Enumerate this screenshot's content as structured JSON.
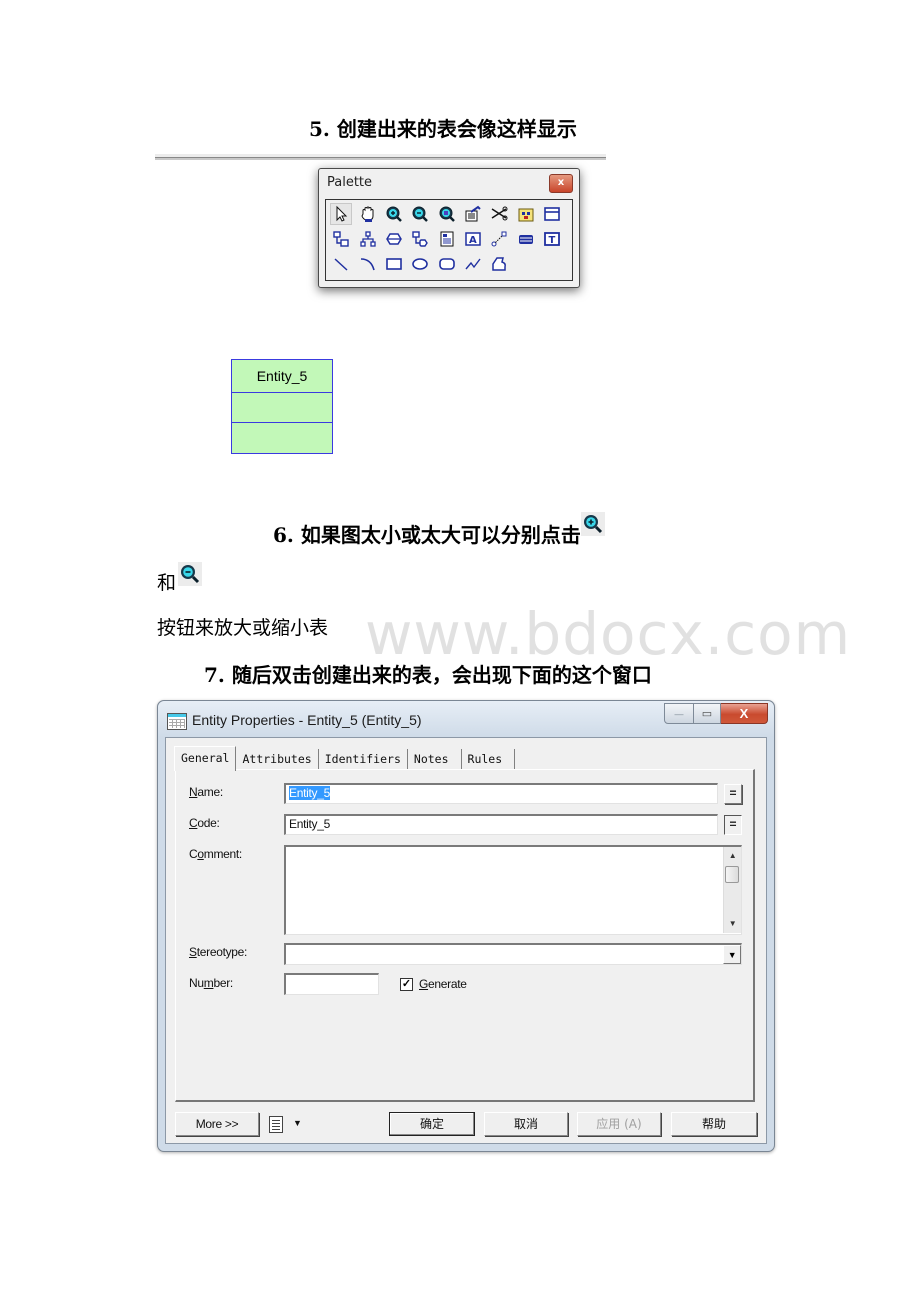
{
  "step5": {
    "heading": "5. 创建出来的表会像这样显示"
  },
  "palette": {
    "title": "Palette",
    "close_label": "x",
    "tools": [
      [
        "pointer",
        "hand",
        "zoom-in",
        "zoom-out",
        "zoom-fit",
        "properties",
        "cut",
        "package",
        "entity"
      ],
      [
        "inheritance",
        "hierarchy",
        "association",
        "association-link",
        "file",
        "text-file",
        "link",
        "table",
        "text"
      ],
      [
        "line",
        "arc",
        "rectangle",
        "ellipse",
        "rounded-rectangle",
        "polyline",
        "polygon"
      ]
    ]
  },
  "entity": {
    "name": "Entity_5"
  },
  "step6": {
    "heading": "6. 如果图太小或太大可以分别点击",
    "line2_prefix": "和",
    "line3": "按钮来放大或缩小表"
  },
  "watermark": "www.bdocx.com",
  "step7": {
    "heading": "7. 随后双击创建出来的表，会出现下面的这个窗口"
  },
  "dialog": {
    "title": "Entity Properties - Entity_5 (Entity_5)",
    "window_buttons": {
      "minimize": "—",
      "maximize": "▭",
      "close": "X"
    },
    "tabs": [
      "General",
      "Attributes",
      "Identifiers",
      "Notes",
      "Rules"
    ],
    "active_tab": "General",
    "fields": {
      "name": {
        "label_mnemonic": "N",
        "label_rest": "ame:",
        "value": "Entity_5"
      },
      "code": {
        "label_mnemonic": "C",
        "label_rest": "ode:",
        "value": "Entity_5"
      },
      "comment": {
        "label_pre": "C",
        "label_mnemonic": "o",
        "label_rest": "mment:",
        "value": ""
      },
      "stereotype": {
        "label_mnemonic": "S",
        "label_rest": "tereotype:",
        "value": ""
      },
      "number": {
        "label_pre": "Nu",
        "label_mnemonic": "m",
        "label_rest": "ber:",
        "value": ""
      },
      "generate": {
        "label_mnemonic": "G",
        "label_rest": "enerate",
        "checked": true
      }
    },
    "eq_label": "=",
    "buttons": {
      "more": "More >>",
      "ok": "确定",
      "cancel": "取消",
      "apply": "应用 (A)",
      "help": "帮助"
    }
  }
}
